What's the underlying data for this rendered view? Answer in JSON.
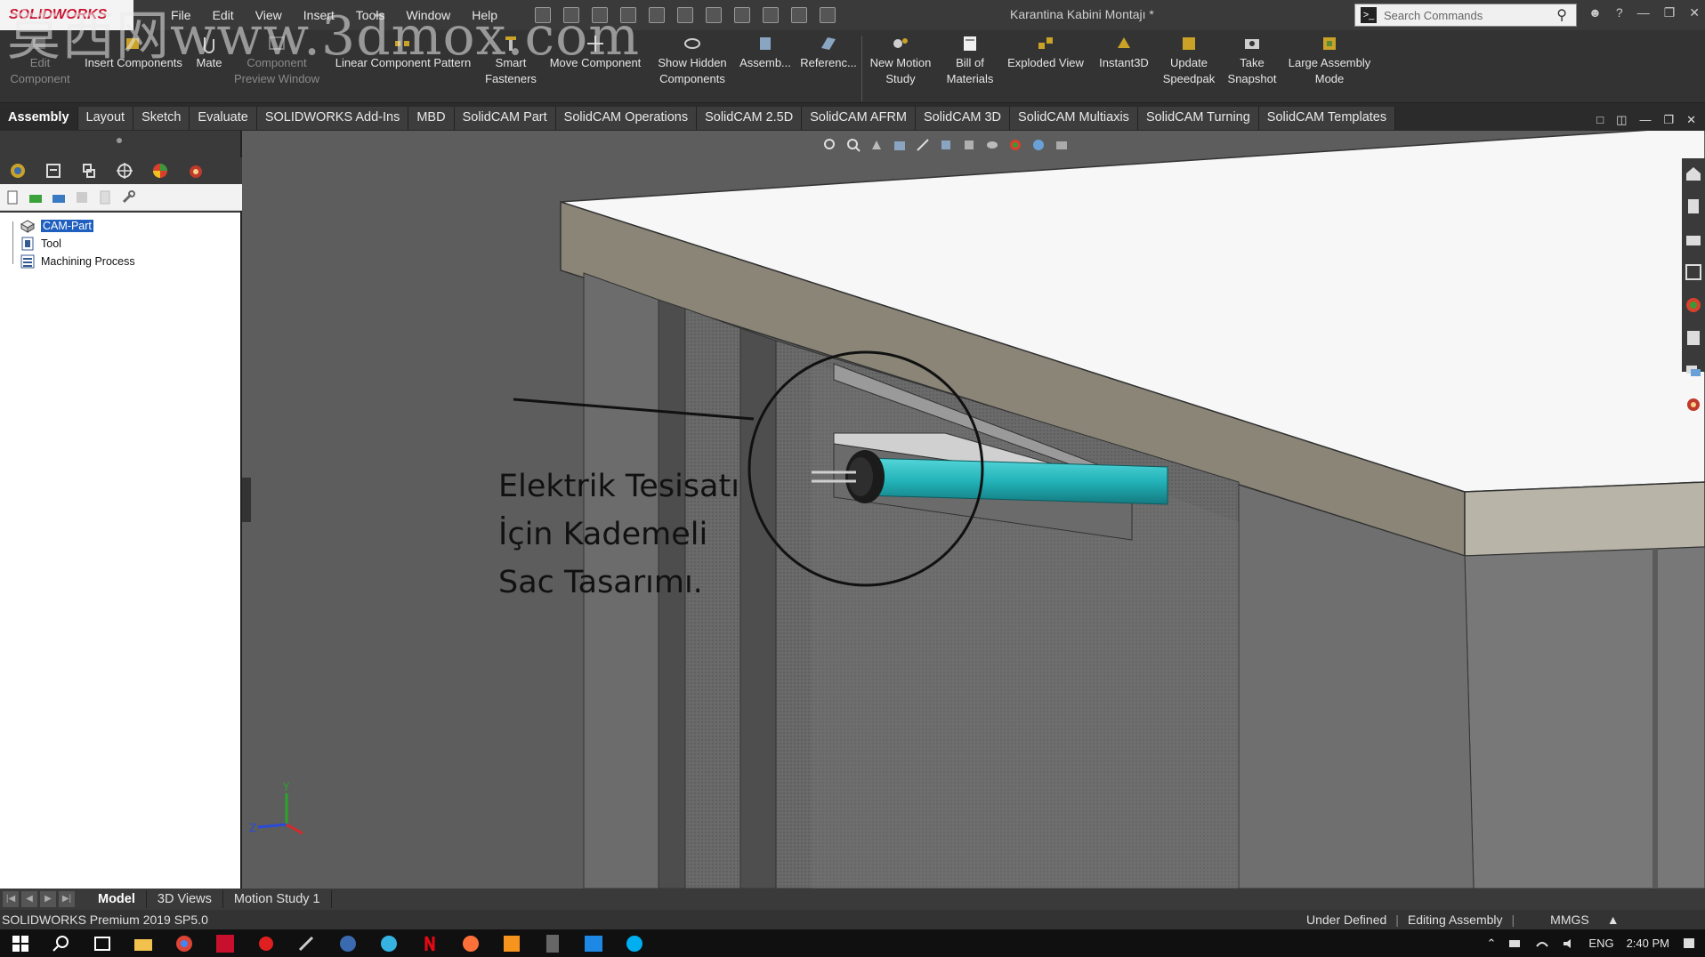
{
  "app": {
    "logo_text": "SOLIDWORKS",
    "document_title": "Karantina Kabini Montajı *",
    "search_placeholder": "Search Commands"
  },
  "menu": [
    "File",
    "Edit",
    "View",
    "Insert",
    "Tools",
    "Window",
    "Help"
  ],
  "ribbon": {
    "edit_component": "Edit Component",
    "insert_components": "Insert Components",
    "mate": "Mate",
    "component_preview": "Component Preview Window",
    "linear_pattern": "Linear Component Pattern",
    "smart_fasteners": "Smart Fasteners",
    "move_component": "Move Component",
    "show_hidden": "Show Hidden Components",
    "assembly": "Assemb...",
    "reference": "Referenc...",
    "new_motion": "New Motion Study",
    "bom": "Bill of Materials",
    "exploded_view": "Exploded View",
    "instant3d": "Instant3D",
    "update_speedpak": "Update Speedpak",
    "take_snapshot": "Take Snapshot",
    "large_assembly": "Large Assembly Mode"
  },
  "tabs": [
    "Assembly",
    "Layout",
    "Sketch",
    "Evaluate",
    "SOLIDWORKS Add-Ins",
    "MBD",
    "SolidCAM Part",
    "SolidCAM Operations",
    "SolidCAM 2.5D",
    "SolidCAM AFRM",
    "SolidCAM 3D",
    "SolidCAM Multiaxis",
    "SolidCAM Turning",
    "SolidCAM Templates"
  ],
  "tree": {
    "items": [
      "CAM-Part",
      "Tool",
      "Machining Process"
    ]
  },
  "annotation": {
    "line1": "Elektrik Tesisatı",
    "line2": "İçin Kademeli",
    "line3": "Sac Tasarımı."
  },
  "triad": {
    "y": "Y",
    "z": "Z"
  },
  "bottom_tabs": [
    "Model",
    "3D Views",
    "Motion Study 1"
  ],
  "status": {
    "product": "SOLIDWORKS Premium 2019 SP5.0",
    "state": "Under Defined",
    "mode": "Editing Assembly",
    "units": "MMGS"
  },
  "taskbar": {
    "language": "ENG",
    "time": "2:40 PM"
  },
  "watermark": "莫西网www.3dmox.com",
  "colors": {
    "accent_blue": "#1f5fbf",
    "cylinder": "#22b3b8",
    "viewport_bg": "#5d5d5d"
  }
}
